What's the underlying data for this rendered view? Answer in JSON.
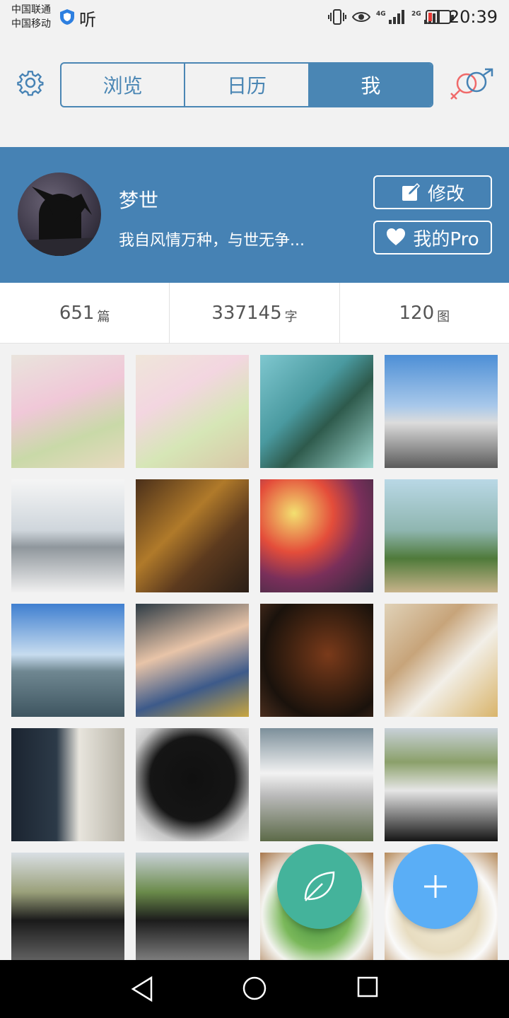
{
  "status": {
    "carrier1": "中国联通",
    "carrier2": "中国移动",
    "listen_label": "听",
    "network1": "4G",
    "network2": "2G",
    "time": "20:39"
  },
  "tabs": [
    {
      "label": "浏览",
      "active": false
    },
    {
      "label": "日历",
      "active": false
    },
    {
      "label": "我",
      "active": true
    }
  ],
  "profile": {
    "name": "梦世",
    "motto": "我自风情万种，与世无争...",
    "edit_label": "修改",
    "pro_label": "我的Pro"
  },
  "stats": [
    {
      "value": "651",
      "unit": "篇"
    },
    {
      "value": "337145",
      "unit": "字"
    },
    {
      "value": "120",
      "unit": "图"
    }
  ],
  "photos": [
    {
      "name": "flowers-bouquet-1"
    },
    {
      "name": "flowers-bouquet-2"
    },
    {
      "name": "food-tray"
    },
    {
      "name": "station-building"
    },
    {
      "name": "glass-hall"
    },
    {
      "name": "lantern-shop"
    },
    {
      "name": "colorful-lanterns"
    },
    {
      "name": "lakeside-path"
    },
    {
      "name": "lake-sky"
    },
    {
      "name": "hand-ticket"
    },
    {
      "name": "sizzling-steak"
    },
    {
      "name": "buffet-plates"
    },
    {
      "name": "museum-wall"
    },
    {
      "name": "museum-sign"
    },
    {
      "name": "white-car-road"
    },
    {
      "name": "cars-traffic"
    },
    {
      "name": "black-suv-parking"
    },
    {
      "name": "black-suv-highway"
    },
    {
      "name": "vegetable-bowl"
    },
    {
      "name": "noodle-plate"
    }
  ],
  "colors": {
    "accent": "#4682b4",
    "leaf_fab": "#44b39b",
    "add_fab": "#5aaef6"
  }
}
